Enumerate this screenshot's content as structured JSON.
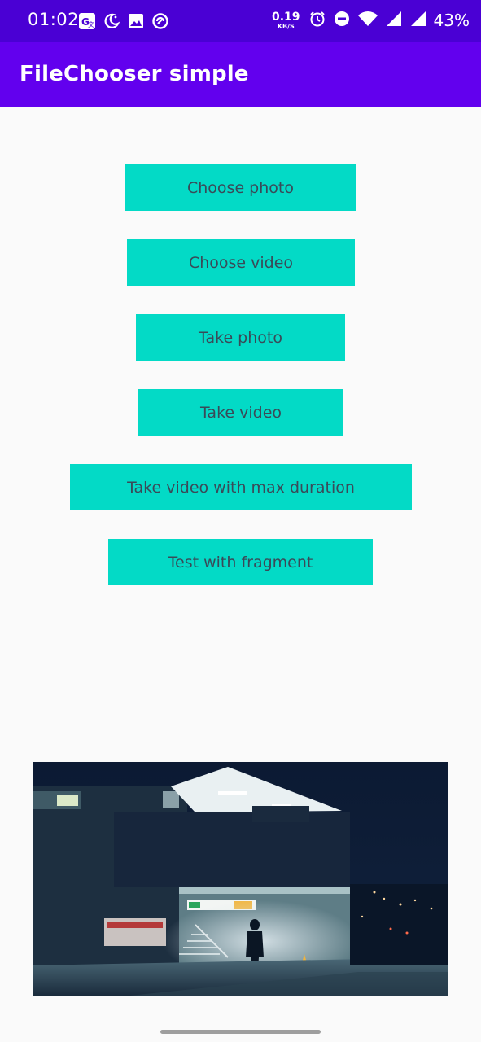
{
  "status_bar": {
    "time": "01:02",
    "net_speed_value": "0.19",
    "net_speed_unit": "KB/S",
    "battery_percent": "43%",
    "left_icons": [
      "translate-icon",
      "do-not-disturb-moon-icon",
      "image-icon",
      "sync-circle-icon"
    ],
    "right_icons": [
      "alarm-icon",
      "dnd-minus-icon",
      "wifi-icon",
      "signal-icon",
      "signal-icon-2"
    ]
  },
  "app_bar": {
    "title": "FileChooser simple"
  },
  "buttons": {
    "choose_photo": "Choose photo",
    "choose_video": "Choose video",
    "take_photo": "Take photo",
    "take_video": "Take video",
    "take_video_max": "Take video with max duration",
    "test_fragment": "Test with fragment"
  },
  "colors": {
    "status_bar": "#4a00d4",
    "app_bar": "#6200ee",
    "button": "#03dac6",
    "button_text": "#3a4a58",
    "background": "#fafafa"
  },
  "preview": {
    "subject": "night-building-photo"
  }
}
